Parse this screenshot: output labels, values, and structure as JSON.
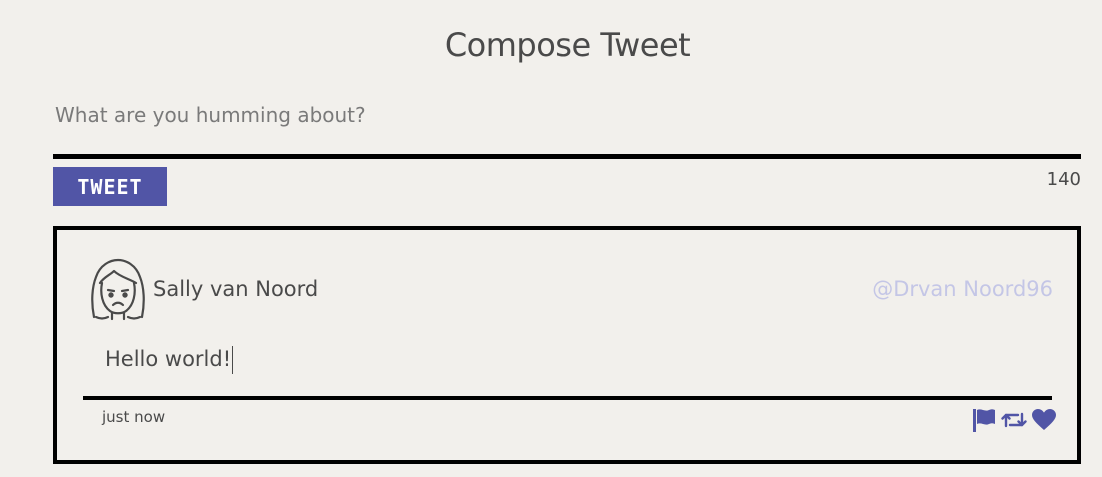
{
  "page": {
    "title": "Compose Tweet"
  },
  "compose": {
    "placeholder": "What are you humming about?",
    "value": "",
    "tweet_button_label": "TWEET",
    "char_count": "140"
  },
  "tweet": {
    "author_name": "Sally van Noord",
    "author_handle": "@Drvan Noord96",
    "text": "Hello world!",
    "timestamp": "just now",
    "avatar_icon": "woman-face-icon",
    "actions": [
      {
        "icon": "flag-icon"
      },
      {
        "icon": "retweet-icon"
      },
      {
        "icon": "heart-icon"
      }
    ]
  },
  "colors": {
    "accent": "#5155a6",
    "handle": "#c4c6e6",
    "background": "#f2f0ec",
    "text": "#4a4a4a"
  }
}
